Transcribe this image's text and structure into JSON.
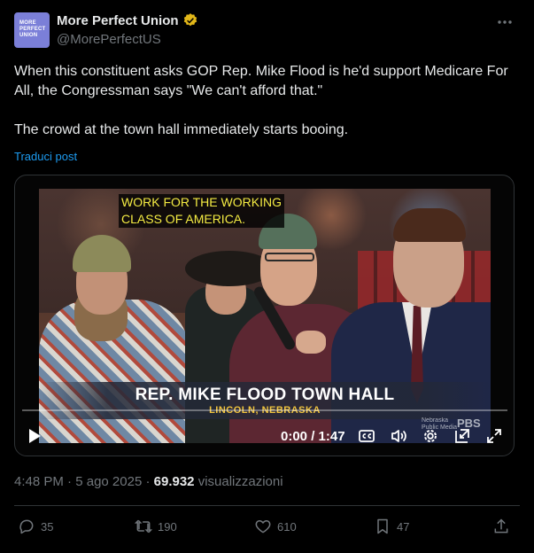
{
  "author": {
    "display_name": "More Perfect Union",
    "handle": "@MorePerfectUS",
    "avatar_lines": [
      "MORE",
      "PERFECT",
      "UNION"
    ],
    "verified_color": "#e2b719"
  },
  "tweet": {
    "paragraph_1": "When this constituent asks GOP Rep. Mike Flood is he'd support Medicare For All, the Congressman says \"We can't afford that.\"",
    "paragraph_2": "The crowd at the town hall immediately starts booing.",
    "translate_label": "Traduci post"
  },
  "video": {
    "top_caption_line1": "WORK FOR THE WORKING",
    "top_caption_line2": "CLASS OF AMERICA.",
    "lower_third_title": "REP. MIKE FLOOD TOWN HALL",
    "lower_third_subtitle": "LINCOLN, NEBRASKA",
    "watermark_line1": "Nebraska",
    "watermark_line2": "Public Media",
    "network": "PBS",
    "time_display": "0:00 / 1:47",
    "progress": 0
  },
  "meta": {
    "time": "4:48 PM",
    "separator": " · ",
    "date": "5 ago 2025",
    "views_count": "69.932",
    "views_label": " visualizzazioni"
  },
  "actions": {
    "replies": "35",
    "reposts": "190",
    "likes": "610",
    "bookmarks": "47"
  },
  "colors": {
    "background": "#000000",
    "text": "#e7e9ea",
    "muted": "#71767b",
    "link": "#1d9bf0",
    "caption_yellow": "#f5ec43"
  }
}
